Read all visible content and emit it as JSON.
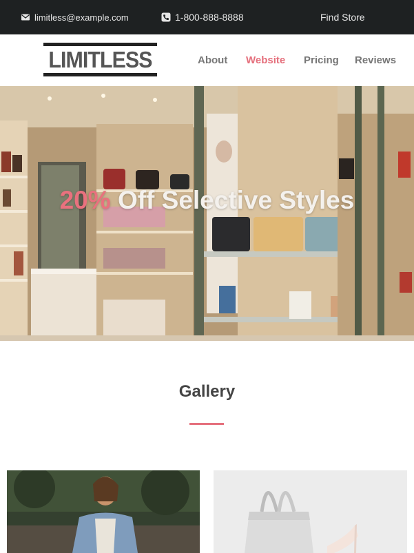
{
  "topbar": {
    "email": "limitless@example.com",
    "phone": "1-800-888-8888",
    "store": "Find Store",
    "email_icon": "envelope-icon",
    "phone_icon": "phone-icon"
  },
  "nav": {
    "logo": "LIMITLESS",
    "items": [
      {
        "label": "About",
        "active": false
      },
      {
        "label": "Website",
        "active": true
      },
      {
        "label": "Pricing",
        "active": false
      },
      {
        "label": "Reviews",
        "active": false
      }
    ]
  },
  "hero": {
    "accent": "20%",
    "title": "Off Selective Styles"
  },
  "gallery": {
    "title": "Gallery"
  },
  "colors": {
    "accent": "#e56f7c",
    "topbar_bg": "#1e2122"
  }
}
